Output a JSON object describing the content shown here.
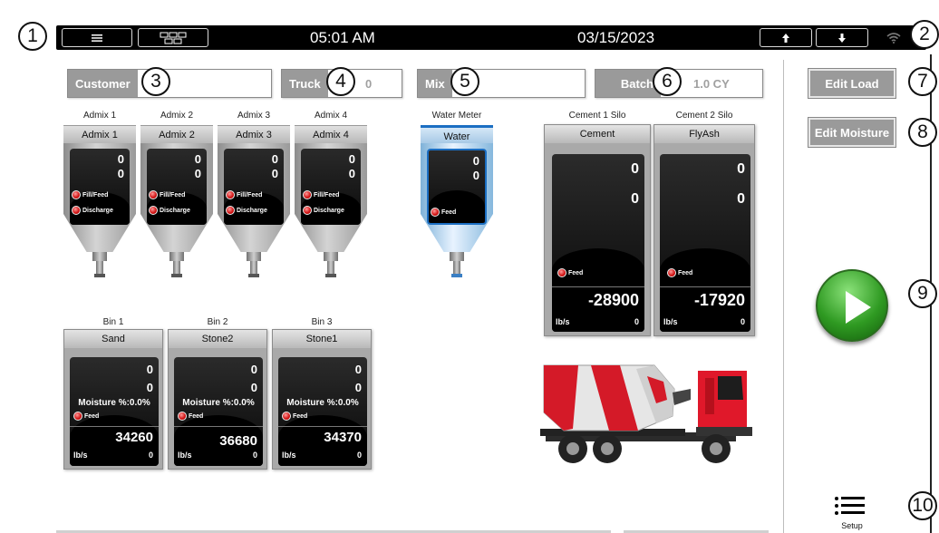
{
  "topbar": {
    "menu_icon": "hamburger-icon",
    "network_icon": "network-icon",
    "time": "05:01 AM",
    "date": "03/15/2023",
    "upload_icon": "arrow-up-icon",
    "download_icon": "arrow-down-icon",
    "wifi_icon": "wifi-icon"
  },
  "callouts": [
    "1",
    "2",
    "3",
    "4",
    "5",
    "6",
    "7",
    "8",
    "9",
    "10"
  ],
  "fields": {
    "customer": {
      "label": "Customer",
      "value": ""
    },
    "truck": {
      "label": "Truck",
      "value": "0"
    },
    "mix": {
      "label": "Mix",
      "value": ""
    },
    "batch": {
      "label": "Batch",
      "value": "1.0 CY"
    }
  },
  "buttons": {
    "edit_load": "Edit Load",
    "edit_moisture": "Edit Moisture",
    "setup": "Setup"
  },
  "admixes": [
    {
      "caption": "Admix 1",
      "label": "Admix 1",
      "v1": "0",
      "v2": "0",
      "led1": "Fill/Feed",
      "led2": "Discharge"
    },
    {
      "caption": "Admix 2",
      "label": "Admix 2",
      "v1": "0",
      "v2": "0",
      "led1": "Fill/Feed",
      "led2": "Discharge"
    },
    {
      "caption": "Admix 3",
      "label": "Admix 3",
      "v1": "0",
      "v2": "0",
      "led1": "Fill/Feed",
      "led2": "Discharge"
    },
    {
      "caption": "Admix 4",
      "label": "Admix 4",
      "v1": "0",
      "v2": "0",
      "led1": "Fill/Feed",
      "led2": "Discharge"
    }
  ],
  "water": {
    "caption": "Water Meter",
    "label": "Water",
    "v1": "0",
    "v2": "0",
    "led": "Feed"
  },
  "cements": [
    {
      "caption": "Cement 1 Silo",
      "label": "Cement",
      "v1": "0",
      "v2": "0",
      "led": "Feed",
      "total": "-28900",
      "unit": "lb/s",
      "rate": "0"
    },
    {
      "caption": "Cement 2 Silo",
      "label": "FlyAsh",
      "v1": "0",
      "v2": "0",
      "led": "Feed",
      "total": "-17920",
      "unit": "lb/s",
      "rate": "0"
    }
  ],
  "bins": [
    {
      "caption": "Bin 1",
      "label": "Sand",
      "v1": "0",
      "v2": "0",
      "moisture": "Moisture %:0.0%",
      "led": "Feed",
      "total": "34260",
      "unit": "lb/s",
      "rate": "0"
    },
    {
      "caption": "Bin 2",
      "label": "Stone2",
      "v1": "0",
      "v2": "0",
      "moisture": "Moisture %:0.0%",
      "led": "Feed",
      "total": "36680",
      "unit": "lb/s",
      "rate": "0"
    },
    {
      "caption": "Bin 3",
      "label": "Stone1",
      "v1": "0",
      "v2": "0",
      "moisture": "Moisture %:0.0%",
      "led": "Feed",
      "total": "34370",
      "unit": "lb/s",
      "rate": "0"
    }
  ],
  "colors": {
    "accent_green": "#2f9a22",
    "led_red": "#d01010",
    "water_blue": "#1b6ec2",
    "truck_red": "#e0182a"
  }
}
